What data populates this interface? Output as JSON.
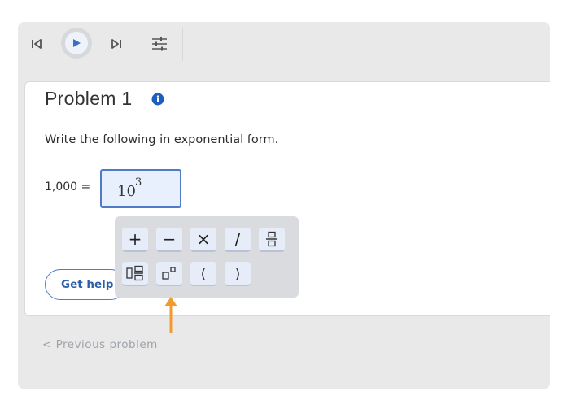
{
  "toolbar": {
    "skip_back_icon": "skip-back-icon",
    "play_icon": "play-icon",
    "skip_forward_icon": "skip-forward-icon",
    "settings_icon": "sliders-icon"
  },
  "problem": {
    "title": "Problem 1",
    "info_icon": "info-icon",
    "prompt": "Write the following in exponential form.",
    "equation_label": "1,000 =",
    "answer": {
      "base": "10",
      "exponent": "3"
    },
    "help_button": "Get help"
  },
  "keypad": {
    "keys": [
      {
        "label": "+",
        "name": "plus"
      },
      {
        "label": "−",
        "name": "minus"
      },
      {
        "label": "×",
        "name": "times"
      },
      {
        "label": "/",
        "name": "slash"
      },
      {
        "label": "",
        "name": "fraction"
      },
      {
        "label": "",
        "name": "mixed-fraction"
      },
      {
        "label": "",
        "name": "exponent"
      },
      {
        "label": "(",
        "name": "open-paren"
      },
      {
        "label": ")",
        "name": "close-paren"
      }
    ]
  },
  "footer": {
    "previous_link": "< Previous problem"
  },
  "colors": {
    "accent": "#4f7bc8",
    "info": "#1d5fbd",
    "arrow": "#f39a2e",
    "frame": "#e9e9ea"
  }
}
